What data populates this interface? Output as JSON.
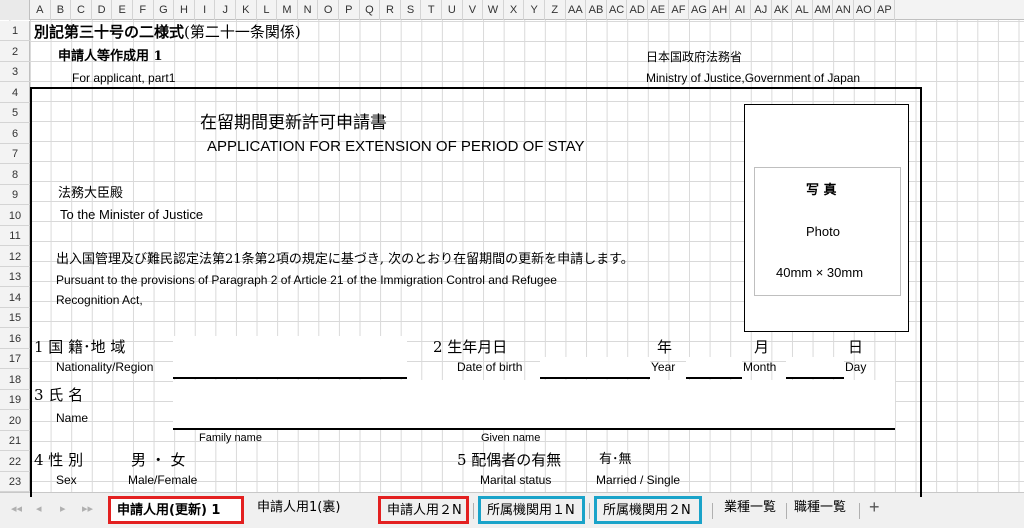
{
  "columns": [
    "A",
    "B",
    "C",
    "D",
    "E",
    "F",
    "G",
    "H",
    "I",
    "J",
    "K",
    "L",
    "M",
    "N",
    "O",
    "P",
    "Q",
    "R",
    "S",
    "T",
    "U",
    "V",
    "W",
    "X",
    "Y",
    "Z",
    "AA",
    "AB",
    "AC",
    "AD",
    "AE",
    "AF",
    "AG",
    "AH",
    "AI",
    "AJ",
    "AK",
    "AL",
    "AM",
    "AN",
    "AO",
    "AP"
  ],
  "rows": [
    "1",
    "2",
    "3",
    "4",
    "5",
    "6",
    "7",
    "8",
    "9",
    "10",
    "11",
    "12",
    "13",
    "14",
    "15",
    "16",
    "17",
    "18",
    "19",
    "20",
    "21",
    "22",
    "23"
  ],
  "form": {
    "title_jp": "別記第三十号の二様式",
    "title_jp_paren": "(第二十一条関係)",
    "applicant_part_jp": "申請人等作成用 1",
    "applicant_part_en": "For applicant, part1",
    "ministry_jp": "日本国政府法務省",
    "ministry_en": "Ministry of Justice,Government of Japan",
    "app_title_jp": "在留期間更新許可申請書",
    "app_title_en": "APPLICATION FOR EXTENSION OF PERIOD OF STAY",
    "minister_jp": "法務大臣殿",
    "minister_en": "To the Minister of Justice",
    "pursuant_jp": "出入国管理及び難民認定法第21条第2項の規定に基づき, 次のとおり在留期間の更新を申請します。",
    "pursuant_en_1": "Pursuant to the provisions of Paragraph 2 of Article 21 of the Immigration Control and Refugee",
    "pursuant_en_2": "Recognition Act,",
    "photo_jp": "写 真",
    "photo_en": "Photo",
    "photo_size": "40mm × 30mm",
    "nationality_jp": "1 国 籍･地 域",
    "nationality_en": "Nationality/Region",
    "dob_jp": "2 生年月日",
    "dob_en": "Date of birth",
    "year_jp": "年",
    "year_en": "Year",
    "month_jp": "月",
    "month_en": "Month",
    "day_jp": "日",
    "day_en": "Day",
    "name_jp": "3 氏 名",
    "name_en": "Name",
    "family_name": "Family name",
    "given_name": "Given name",
    "sex_jp": "4 性 別",
    "sex_options_jp": "男 ・ 女",
    "sex_en": "Sex",
    "sex_options_en": "Male/Female",
    "marital_jp": "5 配偶者の有無",
    "marital_options_jp": "有･無",
    "marital_en": "Marital status",
    "marital_options_en": "Married / Single"
  },
  "tabs": {
    "nav_first": "◂◂",
    "nav_prev": "◂",
    "nav_next": "▸",
    "nav_last": "▸▸",
    "items": [
      {
        "label": "申請人用(更新) 1"
      },
      {
        "label": "申請人用1(裏)"
      },
      {
        "label": "申請人用２N"
      },
      {
        "label": "所属機関用１N"
      },
      {
        "label": "所属機関用２N"
      },
      {
        "label": "業種一覧"
      },
      {
        "label": "職種一覧"
      }
    ],
    "add": "+"
  },
  "colors": {
    "highlight_red": "#e32020",
    "highlight_blue": "#1aa3c9",
    "grid": "#d9d9d9"
  }
}
